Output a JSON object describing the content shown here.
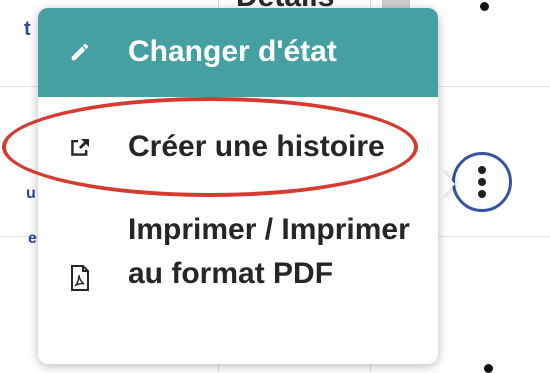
{
  "background": {
    "heading_fragment": "Details"
  },
  "menu": {
    "items": [
      {
        "label": "Changer d'état",
        "icon": "pencil-icon",
        "active": true
      },
      {
        "label": "Créer une histoire",
        "icon": "share-icon",
        "active": false
      },
      {
        "label": "Imprimer / Imprimer au format PDF",
        "icon": "pdf-icon",
        "active": false
      }
    ]
  },
  "colors": {
    "active_item_bg": "#45a0a2",
    "annotation": "#d63b2f",
    "kebab_border": "#35539e"
  },
  "kebab": {
    "icon": "more-vertical-icon"
  }
}
